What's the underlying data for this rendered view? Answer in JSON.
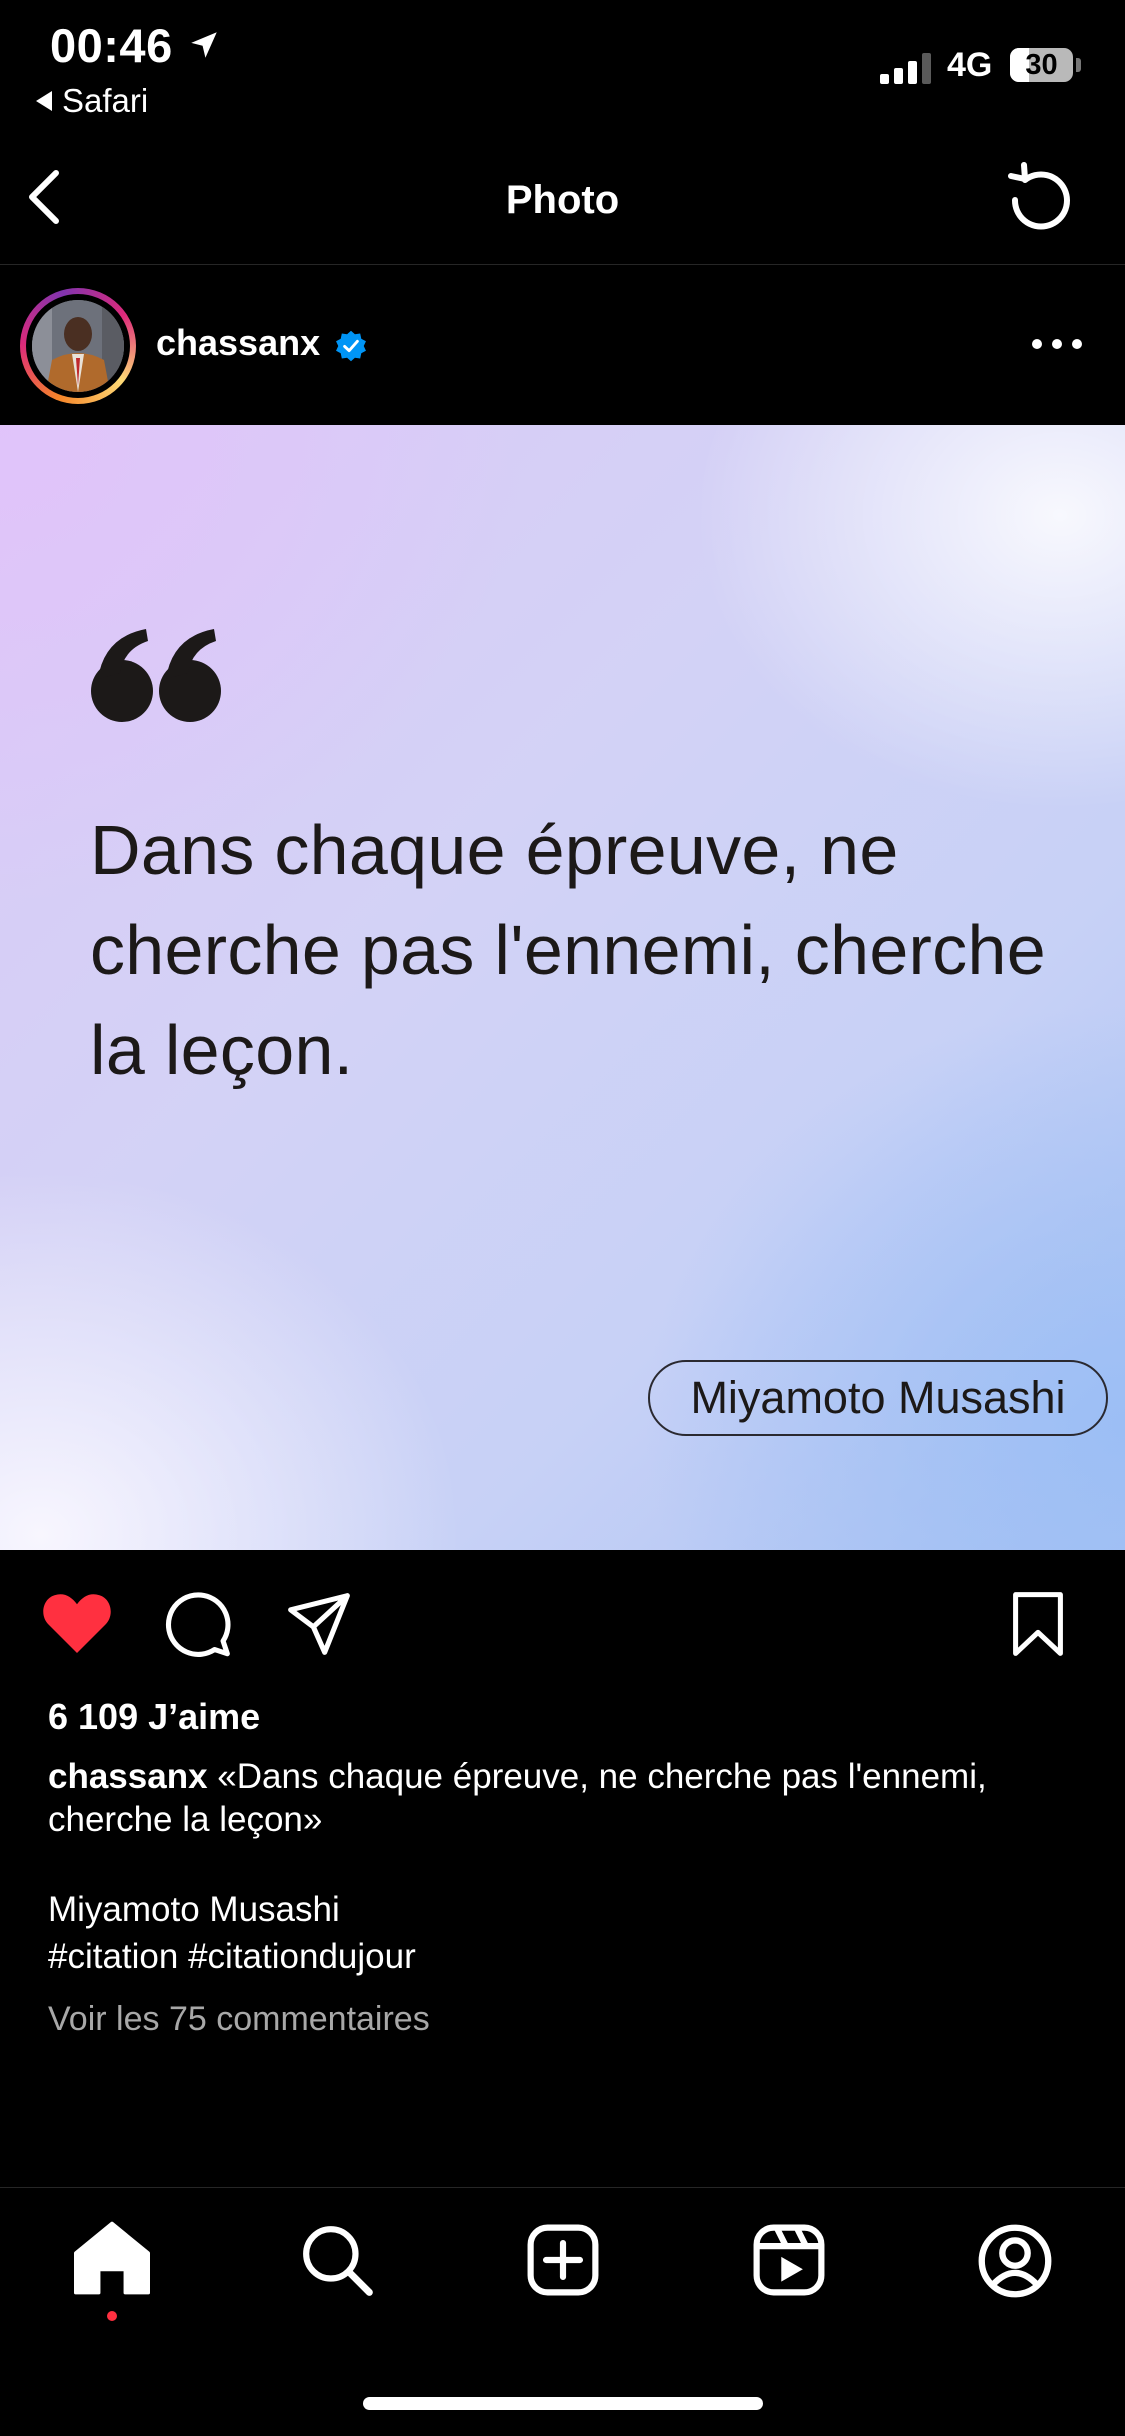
{
  "status_bar": {
    "time": "00:46",
    "back_app": "Safari",
    "network": "4G",
    "battery": "30",
    "battery_fraction": 0.3
  },
  "nav": {
    "title": "Photo"
  },
  "post": {
    "username": "chassanx",
    "image": {
      "quote": "Dans chaque épreuve, ne cherche pas l'ennemi, cherche la leçon.",
      "author": "Miyamoto Musashi"
    },
    "likes": "6 109 J’aime",
    "caption_user": "chassanx",
    "caption_text": "«Dans chaque épreuve, ne cherche pas l'ennemi, cherche la leçon»",
    "caption_line_author": "Miyamoto Musashi",
    "caption_line_tags": "#citation #citationdujour",
    "comments_link": "Voir les 75 commentaires",
    "liked": true
  },
  "colors": {
    "like_red": "#ff3040",
    "verified_blue": "#0095f6",
    "muted_text": "#a8a8a8"
  },
  "tab_bar": {
    "items": [
      "home-icon",
      "search-icon",
      "create-icon",
      "reels-icon",
      "profile-icon"
    ],
    "active": "home-icon"
  }
}
